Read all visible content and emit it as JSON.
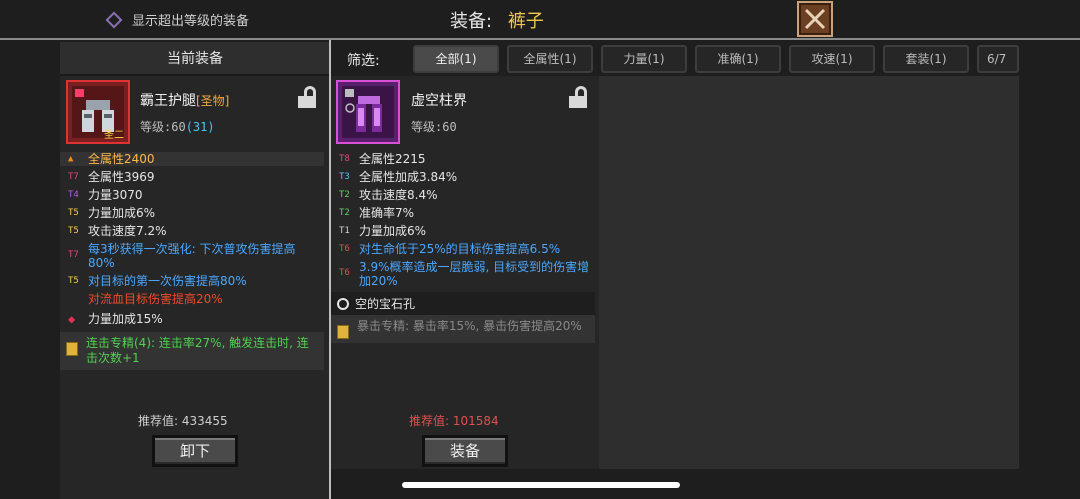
{
  "topbar": {
    "toggle_label": "显示超出等级的装备",
    "title_label": "装备:",
    "title_value": "裤子"
  },
  "equipped": {
    "header": "当前装备",
    "name": "霸王护腿",
    "quality": "[圣物]",
    "icon_tag": "圣二",
    "level_text": "等级:60",
    "level_bonus": "(31)",
    "stats": [
      {
        "tier": "",
        "text": "全属性2400",
        "color": "orange",
        "highlight": true
      },
      {
        "tier": "T7",
        "text": "全属性3969",
        "color": "white"
      },
      {
        "tier": "T4",
        "text": "力量3070",
        "color": "white"
      },
      {
        "tier": "T5",
        "text": "力量加成6%",
        "color": "white"
      },
      {
        "tier": "T5",
        "text": "攻击速度7.2%",
        "color": "white"
      },
      {
        "tier": "T7",
        "text": "每3秒获得一次强化: 下次普攻伤害提高80%",
        "color": "blue"
      },
      {
        "tier": "T5",
        "text": "对目标的第一次伤害提高80%",
        "color": "blue"
      },
      {
        "tier": "",
        "text": "对流血目标伤害提高20%",
        "color": "red"
      }
    ],
    "gem": "力量加成15%",
    "suit": "连击专精(4): 连击率27%, 触发连击时, 连击次数+1",
    "recommend": "推荐值: 433455",
    "unequip_button": "卸下"
  },
  "filter": {
    "label": "筛选:",
    "tabs": [
      "全部(1)",
      "全属性(1)",
      "力量(1)",
      "准确(1)",
      "攻速(1)",
      "套装(1)",
      "6/7阶"
    ]
  },
  "candidate": {
    "name": "虚空柱界",
    "level_text": "等级:60",
    "stats": [
      {
        "tier": "T8",
        "text": "全属性2215",
        "color": "white"
      },
      {
        "tier": "T3",
        "text": "全属性加成3.84%",
        "color": "white"
      },
      {
        "tier": "T2",
        "text": "攻击速度8.4%",
        "color": "white"
      },
      {
        "tier": "T2",
        "text": "准确率7%",
        "color": "white"
      },
      {
        "tier": "T1",
        "text": "力量加成6%",
        "color": "white"
      },
      {
        "tier": "T6",
        "text": "对生命低于25%的目标伤害提高6.5%",
        "color": "blue"
      },
      {
        "tier": "T6",
        "text": "3.9%概率造成一层脆弱, 目标受到的伤害增加20%",
        "color": "blue"
      }
    ],
    "slot": "空的宝石孔",
    "suit": "暴击专精: 暴击率15%, 暴击伤害提高20%",
    "recommend": "推荐值: 101584",
    "equip_button": "装备"
  },
  "colors": {
    "accent": "#f2c94c",
    "relic_border": "#dd3333",
    "candidate_border": "#d84fd8",
    "recommend_red": "#e05050"
  },
  "icons": [
    "diamond-checkbox-icon",
    "close-icon",
    "lock-open-icon",
    "gem-icon",
    "book-icon",
    "circle-icon"
  ]
}
